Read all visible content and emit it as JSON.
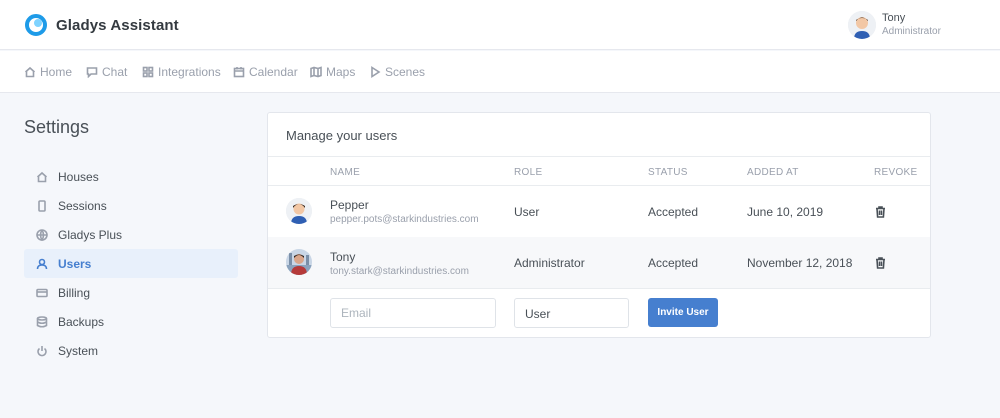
{
  "app": {
    "brand_name": "Gladys Assistant",
    "user_name": "Tony",
    "user_role": "Administrator"
  },
  "nav": {
    "items": [
      {
        "label": "Home",
        "icon": "home-icon"
      },
      {
        "label": "Chat",
        "icon": "chat-icon"
      },
      {
        "label": "Integrations",
        "icon": "grid-icon"
      },
      {
        "label": "Calendar",
        "icon": "calendar-icon"
      },
      {
        "label": "Maps",
        "icon": "map-icon"
      },
      {
        "label": "Scenes",
        "icon": "play-icon"
      }
    ]
  },
  "sidebar": {
    "title": "Settings",
    "items": [
      {
        "label": "Houses",
        "icon": "home-icon"
      },
      {
        "label": "Sessions",
        "icon": "device-icon"
      },
      {
        "label": "Gladys Plus",
        "icon": "globe-icon"
      },
      {
        "label": "Users",
        "icon": "user-icon",
        "active": true
      },
      {
        "label": "Billing",
        "icon": "credit-card-icon"
      },
      {
        "label": "Backups",
        "icon": "database-icon"
      },
      {
        "label": "System",
        "icon": "power-icon"
      }
    ]
  },
  "users_card": {
    "title": "Manage your users",
    "columns": [
      "NAME",
      "ROLE",
      "STATUS",
      "ADDED AT",
      "REVOKE"
    ],
    "rows": [
      {
        "name": "Pepper",
        "email": "pepper.pots@starkindustries.com",
        "role": "User",
        "status": "Accepted",
        "added_at": "June 10, 2019"
      },
      {
        "name": "Tony",
        "email": "tony.stark@starkindustries.com",
        "role": "Administrator",
        "status": "Accepted",
        "added_at": "November 12, 2018"
      }
    ],
    "invite": {
      "email_placeholder": "Email",
      "role_value": "User",
      "button_label": "Invite User"
    }
  },
  "colors": {
    "accent": "#467fcf",
    "background": "#f5f7fb",
    "logo": "#1e9be8"
  }
}
